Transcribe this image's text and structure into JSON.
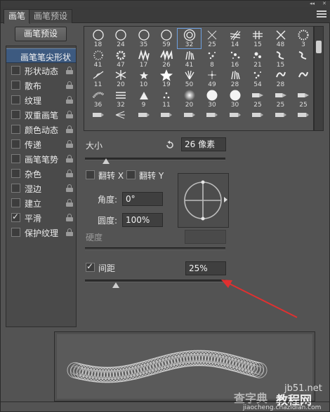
{
  "tabs": [
    {
      "label": "画笔",
      "active": true
    },
    {
      "label": "画笔预设",
      "active": false
    }
  ],
  "window_controls": {
    "collapse": "◂◂",
    "close": "✕"
  },
  "left": {
    "presets_button": "画笔预设",
    "items": [
      {
        "label": "画笔笔尖形状",
        "header": true,
        "checkbox": false,
        "checked": false,
        "lock": false
      },
      {
        "label": "形状动态",
        "checkbox": true,
        "checked": false,
        "lock": true
      },
      {
        "label": "散布",
        "checkbox": true,
        "checked": false,
        "lock": true
      },
      {
        "label": "纹理",
        "checkbox": true,
        "checked": false,
        "lock": true
      },
      {
        "label": "双重画笔",
        "checkbox": true,
        "checked": false,
        "lock": true
      },
      {
        "label": "颜色动态",
        "checkbox": true,
        "checked": false,
        "lock": true
      },
      {
        "label": "传递",
        "checkbox": true,
        "checked": false,
        "lock": true
      },
      {
        "label": "画笔笔势",
        "checkbox": true,
        "checked": false,
        "lock": true
      },
      {
        "label": "杂色",
        "checkbox": true,
        "checked": false,
        "lock": true
      },
      {
        "label": "湿边",
        "checkbox": true,
        "checked": false,
        "lock": true
      },
      {
        "label": "建立",
        "checkbox": true,
        "checked": false,
        "lock": true
      },
      {
        "label": "平滑",
        "checkbox": true,
        "checked": true,
        "lock": true
      },
      {
        "label": "保护纹理",
        "checkbox": true,
        "checked": false,
        "lock": true
      }
    ]
  },
  "brushes": {
    "selected_index": 4,
    "rows": [
      [
        {
          "icon": "circle-thin",
          "num": "18"
        },
        {
          "icon": "circle-thin",
          "num": "24"
        },
        {
          "icon": "circle-thin",
          "num": "35"
        },
        {
          "icon": "circle-thin",
          "num": "59"
        },
        {
          "icon": "circle-double",
          "num": "32"
        },
        {
          "icon": "cross",
          "num": "25"
        },
        {
          "icon": "hatch",
          "num": "14"
        },
        {
          "icon": "hash",
          "num": "15"
        },
        {
          "icon": "cross-fine",
          "num": "48"
        },
        {
          "icon": "dots-ring",
          "num": "3"
        }
      ],
      [
        {
          "icon": "ring-dots",
          "num": "41"
        },
        {
          "icon": "flower",
          "num": "47"
        },
        {
          "icon": "zigzag",
          "num": "17"
        },
        {
          "icon": "starburst",
          "num": "26"
        },
        {
          "icon": "grass",
          "num": "41"
        },
        {
          "icon": "dots",
          "num": "8"
        },
        {
          "icon": "scatter",
          "num": "16"
        },
        {
          "icon": "scatter2",
          "num": "21"
        },
        {
          "icon": "squiggle",
          "num": "15"
        },
        {
          "icon": "squiggle",
          "num": ""
        }
      ],
      [
        {
          "icon": "leaf",
          "num": "11"
        },
        {
          "icon": "snowflake",
          "num": "20"
        },
        {
          "icon": "star-small",
          "num": "10"
        },
        {
          "icon": "star",
          "num": "19"
        },
        {
          "icon": "fan",
          "num": "50"
        },
        {
          "icon": "sparkle",
          "num": "49"
        },
        {
          "icon": "grass",
          "num": "28"
        },
        {
          "icon": "dots",
          "num": "54"
        },
        {
          "icon": "swirl",
          "num": "28"
        },
        {
          "icon": "swirl",
          "num": ""
        }
      ],
      [
        {
          "icon": "feather",
          "num": "36"
        },
        {
          "icon": "stripes",
          "num": "32"
        },
        {
          "icon": "triangle",
          "num": "9"
        },
        {
          "icon": "dots-tri",
          "num": "11"
        },
        {
          "icon": "soft-circle",
          "num": "20"
        },
        {
          "icon": "solid-circle",
          "num": "30"
        },
        {
          "icon": "solid-circle",
          "num": "30"
        },
        {
          "icon": "brush-tip",
          "num": "25"
        },
        {
          "icon": "brush-tip",
          "num": "25"
        },
        {
          "icon": "brush-tip",
          "num": "25"
        }
      ],
      [
        {
          "icon": "pen",
          "num": ""
        },
        {
          "icon": "fan-brush",
          "num": ""
        },
        {
          "icon": "pen",
          "num": ""
        },
        {
          "icon": "pen",
          "num": ""
        },
        {
          "icon": "pen",
          "num": ""
        },
        {
          "icon": "pen",
          "num": ""
        },
        {
          "icon": "pen",
          "num": ""
        },
        {
          "icon": "pen",
          "num": ""
        },
        {
          "icon": "pen",
          "num": ""
        },
        {
          "icon": "pen",
          "num": ""
        }
      ]
    ]
  },
  "size": {
    "label": "大小",
    "value": "26 像素",
    "slider_fraction": 0.1
  },
  "flip": {
    "x_label": "翻转 X",
    "y_label": "翻转 Y",
    "x_checked": false,
    "y_checked": false
  },
  "angle": {
    "label": "角度:",
    "value": "0°"
  },
  "roundness": {
    "label": "圆度:",
    "value": "100%"
  },
  "hardness": {
    "label": "硬度",
    "value": ""
  },
  "spacing": {
    "label": "间距",
    "value": "25%",
    "checked": true,
    "slider_fraction": 0.1
  },
  "watermarks": [
    "jb51.net",
    "查字典",
    "教程网",
    "jiaocheng.chazidian.com"
  ]
}
